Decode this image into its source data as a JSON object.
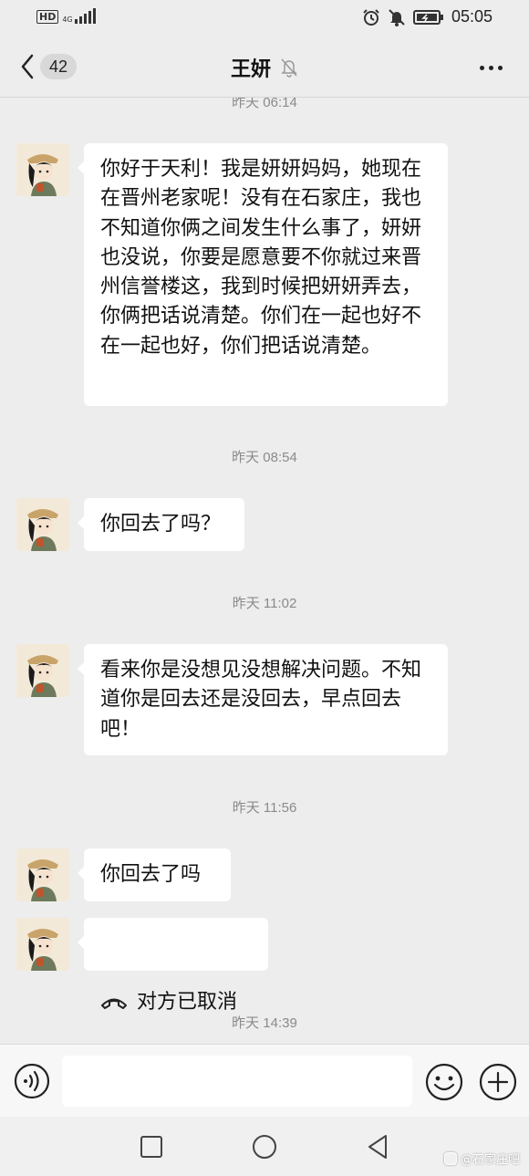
{
  "status_bar": {
    "hd_label": "HD",
    "network_label": "4G",
    "time": "05:05"
  },
  "header": {
    "unread_count": "42",
    "title": "王妍",
    "muted_icon": "bell-off-icon"
  },
  "messages": [
    {
      "timestamp": "昨天 06:14"
    },
    {
      "text": "你好于天利！我是妍妍妈妈，她现在在晋州老家呢！没有在石家庄，我也不知道你俩之间发生什么事了，妍妍也没说，你要是愿意要不你就过来晋州信誉楼这，我到时候把妍妍弄去，你俩把话说清楚。你们在一起也好不在一起也好，你们把话说清楚。"
    },
    {
      "timestamp": "昨天 08:54"
    },
    {
      "text": "你回去了吗？"
    },
    {
      "timestamp": "昨天 11:02"
    },
    {
      "text": "看来你是没想见没想解决问题。不知道你是回去还是没回去，早点回去吧！"
    },
    {
      "timestamp": "昨天 11:56"
    },
    {
      "text": "你回去了吗"
    },
    {
      "call_text": "对方已取消",
      "call_icon": "phone-hangup-icon"
    },
    {
      "timestamp": "昨天 14:39"
    }
  ],
  "input_bar": {
    "placeholder": "",
    "voice_icon": "voice-icon",
    "emoji_icon": "emoji-icon",
    "plus_icon": "plus-icon"
  },
  "watermark": "@石家庄吧",
  "colors": {
    "background": "#ededed",
    "bubble": "#ffffff",
    "timestamp": "#8a8a8a"
  }
}
